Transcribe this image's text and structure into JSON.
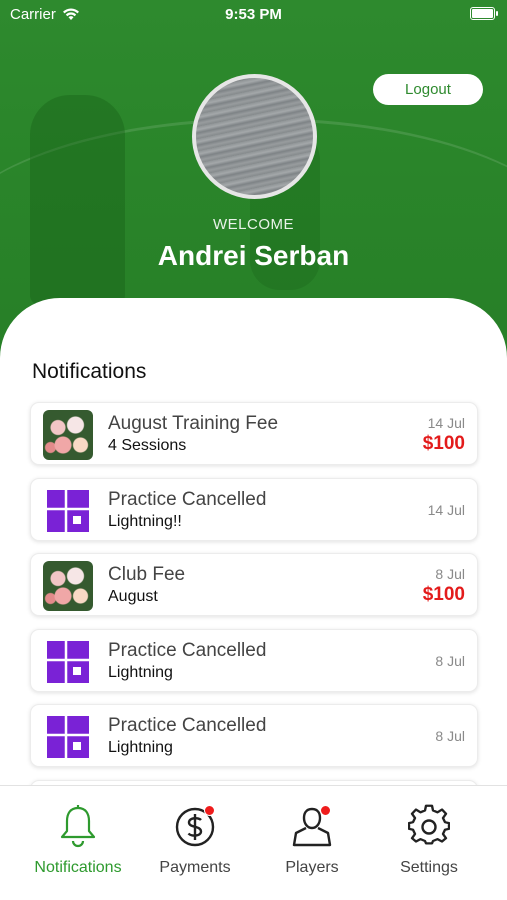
{
  "status_bar": {
    "carrier": "Carrier",
    "time": "9:53 PM"
  },
  "header": {
    "logout_label": "Logout",
    "welcome_label": "WELCOME",
    "user_name": "Andrei Serban"
  },
  "notifications": {
    "title": "Notifications",
    "items": [
      {
        "icon": "flowers-thumbnail",
        "title": "August Training Fee",
        "subtitle": "4 Sessions",
        "date": "14 Jul",
        "amount": "$100"
      },
      {
        "icon": "purple-grid-icon",
        "title": "Practice Cancelled",
        "subtitle": "Lightning!!",
        "date": "14 Jul",
        "amount": ""
      },
      {
        "icon": "flowers-thumbnail",
        "title": "Club Fee",
        "subtitle": "August",
        "date": "8 Jul",
        "amount": "$100"
      },
      {
        "icon": "purple-grid-icon",
        "title": "Practice Cancelled",
        "subtitle": "Lightning",
        "date": "8 Jul",
        "amount": ""
      },
      {
        "icon": "purple-grid-icon",
        "title": "Practice Cancelled",
        "subtitle": "Lightning",
        "date": "8 Jul",
        "amount": ""
      }
    ]
  },
  "tab_bar": {
    "tabs": [
      {
        "label": "Notifications",
        "icon": "bell-icon",
        "active": true,
        "badge": false
      },
      {
        "label": "Payments",
        "icon": "dollar-circle-icon",
        "active": false,
        "badge": true
      },
      {
        "label": "Players",
        "icon": "person-icon",
        "active": false,
        "badge": true
      },
      {
        "label": "Settings",
        "icon": "gear-icon",
        "active": false,
        "badge": false
      }
    ]
  },
  "colors": {
    "header_green": "#2e8a2e",
    "active_tab": "#2e9a2e",
    "amount_red": "#e31b1b",
    "icon_purple": "#7a22d6",
    "badge_red": "#ef1c1c"
  }
}
